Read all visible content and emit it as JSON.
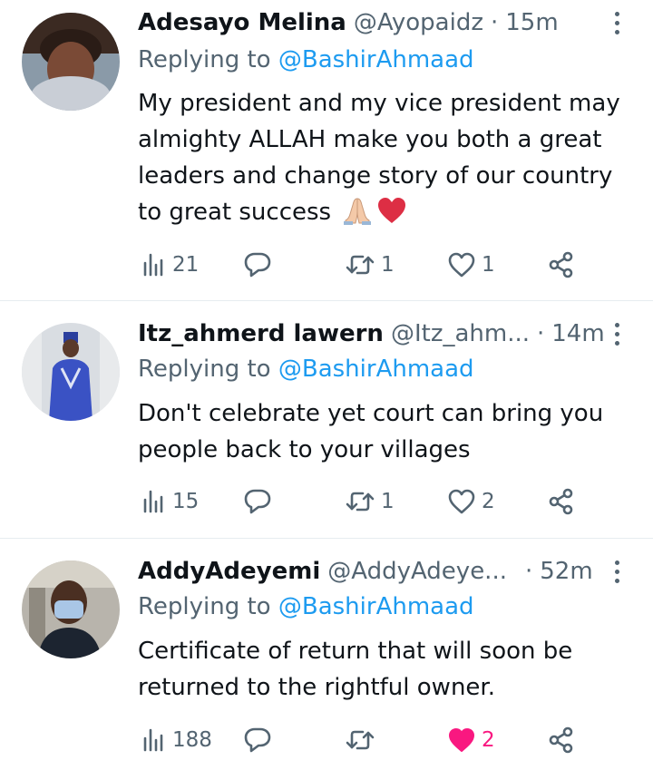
{
  "tweets": [
    {
      "name": "Adesayo Melina",
      "handle": "@Ayopaidz",
      "dot": "·",
      "time": "15m",
      "replying_prefix": "Replying to",
      "replying_to": "@BashirAhmaad",
      "text": "My president and my vice president may almighty ALLAH make you both a great leaders and change story of our country to great success",
      "emojis": [
        "folded-hands",
        "red-heart"
      ],
      "views": "21",
      "replies": "",
      "retweets": "1",
      "likes": "1",
      "liked": false
    },
    {
      "name": "Itz_ahmerd lawern",
      "handle": "@Itz_ahm...",
      "dot": "·",
      "time": "14m",
      "replying_prefix": "Replying to",
      "replying_to": "@BashirAhmaad",
      "text": "Don't celebrate yet court can bring you people back to your villages",
      "views": "15",
      "replies": "",
      "retweets": "1",
      "likes": "2",
      "liked": false
    },
    {
      "name": "AddyAdeyemi",
      "handle": "@AddyAdeye...",
      "dot": "·",
      "time": "52m",
      "replying_prefix": "Replying to",
      "replying_to": "@BashirAhmaad",
      "text": "Certificate of return that will soon be returned to the rightful owner.",
      "views": "188",
      "replies": "",
      "retweets": "",
      "likes": "2",
      "liked": true
    }
  ],
  "colors": {
    "text": "#0f1419",
    "secondary": "#536471",
    "link": "#1d9bf0",
    "like_active": "#f91880",
    "divider": "#e6ecf0"
  },
  "icons": [
    "views-icon",
    "reply-icon",
    "retweet-icon",
    "like-icon",
    "share-icon",
    "more-icon"
  ]
}
